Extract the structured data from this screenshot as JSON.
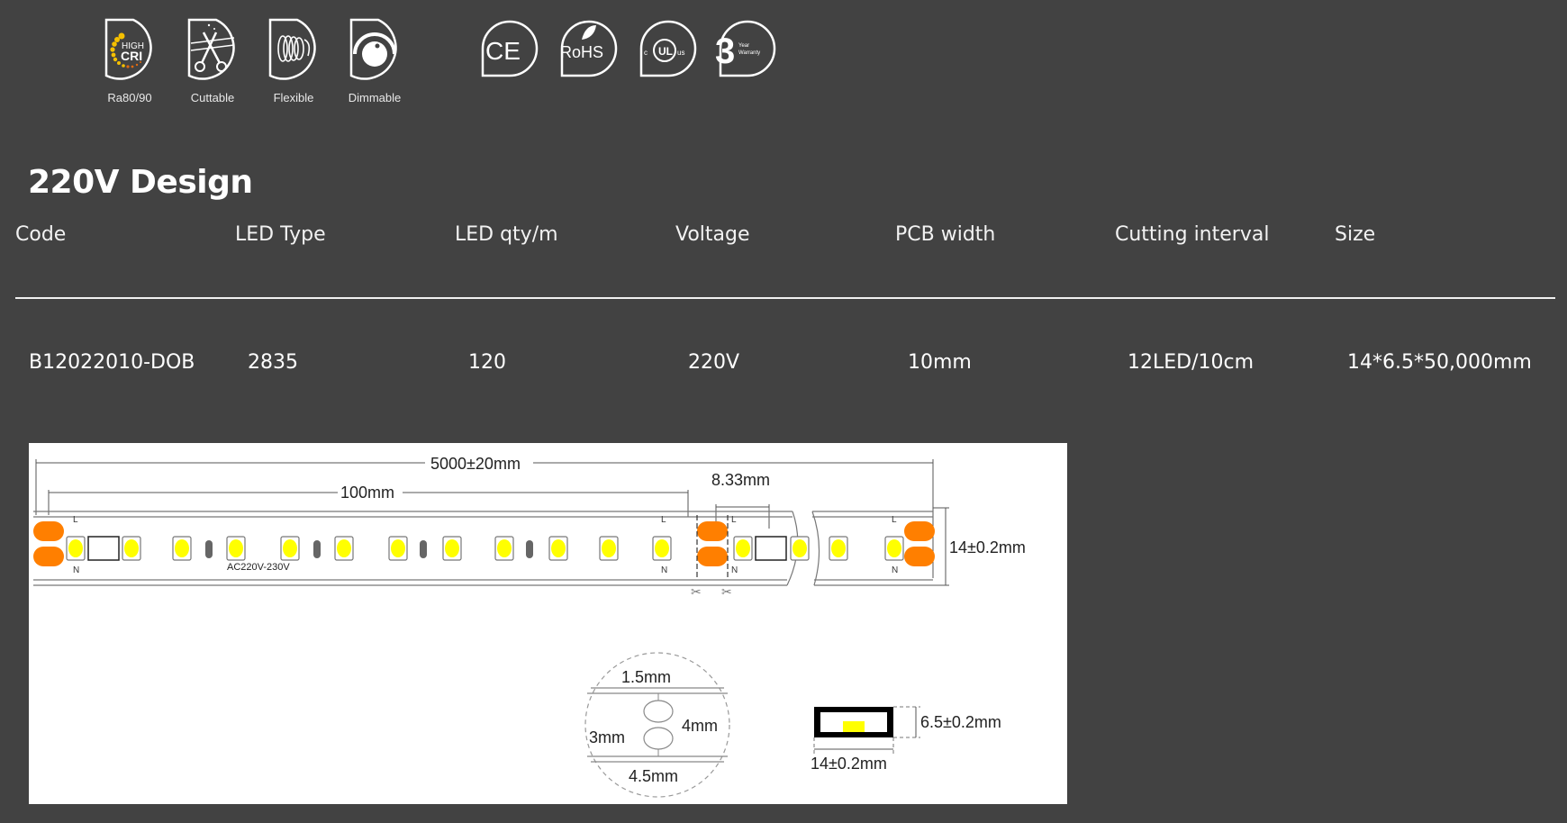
{
  "feature_badges": [
    {
      "icon": "high-cri-icon",
      "label": "Ra80/90",
      "icon_text_top": "HIGH",
      "icon_text_bottom": "CRI"
    },
    {
      "icon": "scissors-icon",
      "label": "Cuttable"
    },
    {
      "icon": "coil-icon",
      "label": "Flexible"
    },
    {
      "icon": "dimmer-knob-icon",
      "label": "Dimmable"
    }
  ],
  "certification_badges": [
    {
      "icon": "ce-mark-icon",
      "text": "CE"
    },
    {
      "icon": "rohs-icon",
      "text": "RoHS"
    },
    {
      "icon": "ul-listed-icon",
      "text": "UL",
      "prefix": "c",
      "suffix": "us"
    },
    {
      "icon": "warranty-icon",
      "text": "3",
      "sub_top": "Year",
      "sub_bottom": "Warranty"
    }
  ],
  "section_title": "220V Design",
  "spec_table": {
    "headers": [
      "Code",
      "LED Type",
      "LED qty/m",
      "Voltage",
      "PCB width",
      "Cutting interval",
      "Size"
    ],
    "rows": [
      [
        "B12022010-DOB",
        "2835",
        "120",
        "220V",
        "10mm",
        "12LED/10cm",
        "14*6.5*50,000mm"
      ]
    ]
  },
  "diagram": {
    "total_length": "5000±20mm",
    "segment_length": "100mm",
    "led_pitch": "8.33mm",
    "strip_width": "14±0.2mm",
    "voltage_marking": "AC220V-230V",
    "pad_labels": {
      "live": "L",
      "neutral": "N"
    },
    "pad_detail": {
      "top_margin": "1.5mm",
      "pad_height": "4mm",
      "pad_gap": "3mm",
      "pad_width": "4.5mm"
    },
    "cross_section": {
      "height": "6.5±0.2mm",
      "width": "14±0.2mm"
    },
    "colors": {
      "led": "#ffff00",
      "pad": "#ff7f00",
      "outline": "#555555"
    }
  }
}
